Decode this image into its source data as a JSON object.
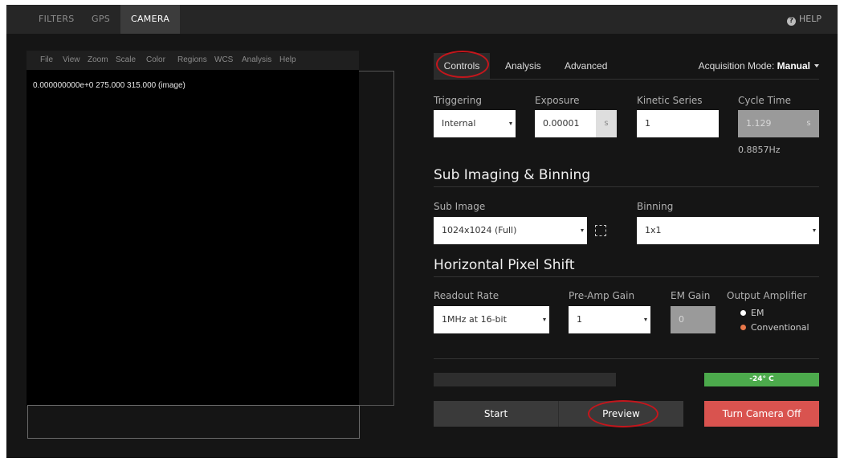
{
  "nav": {
    "tabs": [
      "FILTERS",
      "GPS",
      "CAMERA"
    ],
    "active": "CAMERA",
    "help": "HELP",
    "help_icon": "question-circle-icon"
  },
  "viewer": {
    "menu": [
      "File",
      "View",
      "Zoom",
      "Scale",
      "Color",
      "Regions",
      "WCS",
      "Analysis",
      "Help"
    ],
    "coord": "0.000000000e+0   275.000 315.000 (image)"
  },
  "panel": {
    "tabs": [
      "Controls",
      "Analysis",
      "Advanced"
    ],
    "acquisition_label": "Acquisition Mode:",
    "acquisition_value": "Manual",
    "triggering_label": "Triggering",
    "triggering_value": "Internal",
    "exposure_label": "Exposure",
    "exposure_value": "0.00001",
    "exposure_unit": "s",
    "kinetic_label": "Kinetic Series",
    "kinetic_value": "1",
    "cycle_label": "Cycle Time",
    "cycle_value": "1.129",
    "cycle_unit": "s",
    "frequency": "0.8857Hz",
    "sub_imaging_title": "Sub Imaging & Binning",
    "sub_image_label": "Sub Image",
    "sub_image_value": "1024x1024 (Full)",
    "binning_label": "Binning",
    "binning_value": "1x1",
    "hps_title": "Horizontal Pixel Shift",
    "readout_label": "Readout Rate",
    "readout_value": "1MHz at 16-bit",
    "preamp_label": "Pre-Amp Gain",
    "preamp_value": "1",
    "emgain_label": "EM Gain",
    "emgain_value": "0",
    "output_label": "Output Amplifier",
    "output_options": [
      "EM",
      "Conventional"
    ],
    "output_selected": "Conventional",
    "progress": 0,
    "temperature": "-24° C",
    "start": "Start",
    "preview": "Preview",
    "turn_off": "Turn Camera Off"
  },
  "colors": {
    "annotation": "#c4161c",
    "temp_bar": "#4caa4c",
    "danger": "#d9534f",
    "radio_selected": "#e8774a"
  }
}
